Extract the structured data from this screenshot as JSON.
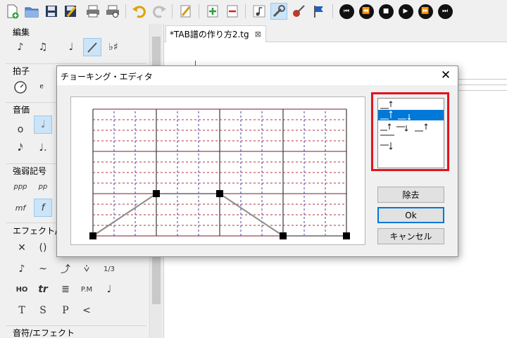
{
  "editor": {
    "tab_title": "*TAB譜の作り方2.tg",
    "tab_close": "⊠"
  },
  "left_panel": {
    "sections": [
      {
        "title": "編集"
      },
      {
        "title": "拍子"
      },
      {
        "title": "音価"
      },
      {
        "title": "強弱記号",
        "items": [
          "ppp",
          "pp",
          "mf",
          "f"
        ]
      },
      {
        "title": "エフェクト/テク",
        "items": [
          "()",
          "1/3",
          "HO",
          "tr",
          "P.M",
          "T",
          "S",
          "P",
          "<"
        ]
      },
      {
        "title": "音符/エフェクト"
      }
    ]
  },
  "toolbar": {
    "icons": [
      "new-file-icon",
      "open-file-icon",
      "save-icon",
      "save-as-icon",
      "print-icon",
      "print-preview-icon",
      "undo-icon",
      "redo-icon",
      "pencil-icon",
      "insert-measure-icon",
      "remove-measure-icon",
      "note-icon",
      "tools-icon",
      "guitar-icon",
      "flag-icon",
      "first-icon",
      "previous-icon",
      "stop-icon",
      "play-icon",
      "next-icon",
      "last-icon"
    ],
    "transport_glyphs": [
      "⏮",
      "⏪",
      "■",
      "▶",
      "⏩",
      "⏭"
    ]
  },
  "dialog": {
    "title": "チョーキング・エディタ",
    "close": "✕",
    "buttons": {
      "remove": "除去",
      "ok": "Ok",
      "cancel": "キャンセル"
    },
    "bend_points": [
      {
        "position": 0,
        "value": 0
      },
      {
        "position": 3,
        "value": 4
      },
      {
        "position": 6,
        "value": 4
      },
      {
        "position": 9,
        "value": 0
      },
      {
        "position": 12,
        "value": 0
      }
    ],
    "grid": {
      "positions": 12,
      "values": 12
    },
    "colors": {
      "highlight": "#0078d7",
      "annotation": "#e0141e",
      "major_line": "#7a1e28",
      "minor_line": "#4040a0"
    }
  }
}
